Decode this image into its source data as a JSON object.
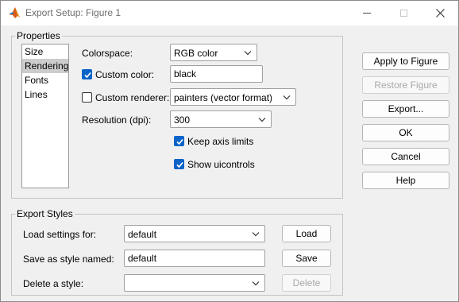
{
  "window": {
    "title": "Export Setup: Figure 1",
    "minimize_icon": "minimize-icon",
    "maximize_icon": "maximize-icon",
    "close_icon": "close-icon",
    "app_icon": "matlab-logo-icon"
  },
  "properties": {
    "group_label": "Properties",
    "list_items": [
      "Size",
      "Rendering",
      "Fonts",
      "Lines"
    ],
    "selected_item": "Rendering",
    "colorspace_label": "Colorspace:",
    "colorspace_value": "RGB color",
    "custom_color_label": "Custom color:",
    "custom_color_checked": true,
    "custom_color_value": "black",
    "custom_renderer_label": "Custom renderer:",
    "custom_renderer_checked": false,
    "custom_renderer_value": "painters (vector format)",
    "resolution_label": "Resolution (dpi):",
    "resolution_value": "300",
    "keep_axis_label": "Keep axis limits",
    "keep_axis_checked": true,
    "show_uicontrols_label": "Show uicontrols",
    "show_uicontrols_checked": true
  },
  "export_styles": {
    "group_label": "Export Styles",
    "load_label": "Load settings for:",
    "load_value": "default",
    "load_button": "Load",
    "save_label": "Save as style named:",
    "save_value": "default",
    "save_button": "Save",
    "delete_label": "Delete a style:",
    "delete_value": "",
    "delete_button": "Delete"
  },
  "actions": {
    "apply": "Apply to Figure",
    "restore": "Restore Figure",
    "export": "Export...",
    "ok": "OK",
    "cancel": "Cancel",
    "help": "Help"
  },
  "colors": {
    "accent": "#0a64c8",
    "selection": "#cccccc",
    "dialog_bg": "#f0f0f0"
  }
}
